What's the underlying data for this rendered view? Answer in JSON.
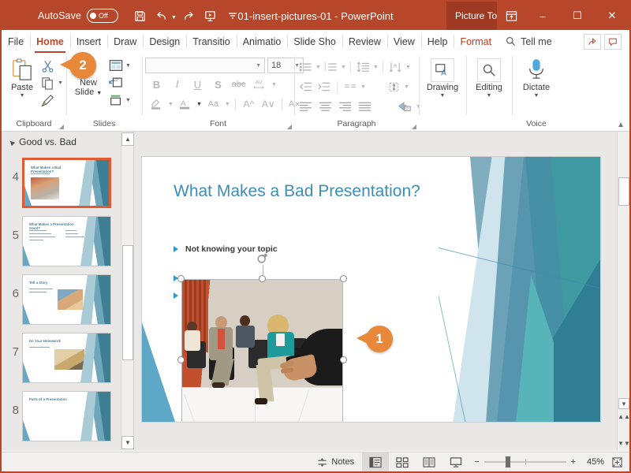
{
  "titlebar": {
    "autosave_label": "AutoSave",
    "autosave_state": "Off",
    "document_title": "01-insert-pictures-01  -  PowerPoint",
    "contextual_tab": "Picture To...",
    "quick_access": [
      {
        "name": "save-icon",
        "label": "Save"
      },
      {
        "name": "undo-icon",
        "label": "Undo"
      },
      {
        "name": "redo-icon",
        "label": "Redo"
      },
      {
        "name": "start-slideshow-icon",
        "label": "Start From Beginning"
      },
      {
        "name": "customize-qat-icon",
        "label": "Customize Quick Access Toolbar"
      }
    ],
    "window_buttons": {
      "ribbon_display": "Ribbon Display Options",
      "minimize": "–",
      "maximize": "☐",
      "close": "✕"
    },
    "accent_color": "#b7472a",
    "contextual_color": "#9e3a21"
  },
  "tabs": [
    {
      "label": "File",
      "active": false
    },
    {
      "label": "Home",
      "active": true
    },
    {
      "label": "Insert",
      "active": false
    },
    {
      "label": "Draw",
      "active": false
    },
    {
      "label": "Design",
      "active": false
    },
    {
      "label": "Transitio",
      "active": false
    },
    {
      "label": "Animatio",
      "active": false
    },
    {
      "label": "Slide Sho",
      "active": false
    },
    {
      "label": "Review",
      "active": false
    },
    {
      "label": "View",
      "active": false
    },
    {
      "label": "Help",
      "active": false
    },
    {
      "label": "Format",
      "active": false
    }
  ],
  "tellme": {
    "label": "Tell me",
    "icon": "search-icon"
  },
  "tab_right_buttons": [
    {
      "name": "share-icon",
      "label": "Share"
    },
    {
      "name": "comments-icon",
      "label": "Comments"
    }
  ],
  "ribbon": {
    "groups": [
      {
        "name": "Clipboard",
        "big_button": {
          "label": "Paste",
          "icon": "paste-icon",
          "has_caret": true
        },
        "small_buttons": [
          {
            "label": "Cut",
            "icon": "cut-icon"
          },
          {
            "label": "Copy",
            "icon": "copy-icon",
            "has_caret": true
          },
          {
            "label": "Format Painter",
            "icon": "format-painter-icon"
          }
        ],
        "has_launcher": true
      },
      {
        "name": "Slides",
        "big_button": {
          "label": "New Slide",
          "icon": "new-slide-icon",
          "has_caret": true
        },
        "small_buttons": [
          {
            "label": "Layout",
            "icon": "layout-icon",
            "has_caret": true
          },
          {
            "label": "Reset",
            "icon": "reset-icon"
          },
          {
            "label": "Section",
            "icon": "section-icon",
            "has_caret": true
          }
        ],
        "has_launcher": false
      },
      {
        "name": "Font",
        "font_name_value": "",
        "font_size_value": "18",
        "buttons": [
          {
            "label": "Bold",
            "icon": "bold-icon",
            "glyph": "B"
          },
          {
            "label": "Italic",
            "icon": "italic-icon",
            "glyph": "I"
          },
          {
            "label": "Underline",
            "icon": "underline-icon",
            "glyph": "U"
          },
          {
            "label": "Text Shadow",
            "icon": "text-shadow-icon",
            "glyph": "S"
          },
          {
            "label": "Strikethrough",
            "icon": "strikethrough-icon",
            "glyph": "abc"
          },
          {
            "label": "Character Spacing",
            "icon": "character-spacing-icon",
            "glyph": "AV"
          },
          {
            "label": "Text Highlight Color",
            "icon": "text-highlight-icon"
          },
          {
            "label": "Font Color",
            "icon": "font-color-icon"
          },
          {
            "label": "Change Case",
            "icon": "change-case-icon",
            "glyph": "Aa"
          },
          {
            "label": "Increase Font Size",
            "icon": "increase-font-size-icon",
            "glyph": "A"
          },
          {
            "label": "Decrease Font Size",
            "icon": "decrease-font-size-icon",
            "glyph": "A"
          },
          {
            "label": "Clear All Formatting",
            "icon": "clear-formatting-icon"
          }
        ],
        "has_launcher": true
      },
      {
        "name": "Paragraph",
        "buttons": [
          {
            "label": "Bullets",
            "icon": "bullets-icon"
          },
          {
            "label": "Numbering",
            "icon": "numbering-icon"
          },
          {
            "label": "Line Spacing",
            "icon": "line-spacing-icon"
          },
          {
            "label": "Text Direction",
            "icon": "text-direction-icon"
          },
          {
            "label": "Decrease Indent",
            "icon": "decrease-indent-icon"
          },
          {
            "label": "Increase Indent",
            "icon": "increase-indent-icon"
          },
          {
            "label": "Add or Remove Columns",
            "icon": "columns-icon"
          },
          {
            "label": "Align Text",
            "icon": "align-text-icon"
          },
          {
            "label": "Align Left",
            "icon": "align-left-icon"
          },
          {
            "label": "Center",
            "icon": "align-center-icon"
          },
          {
            "label": "Align Right",
            "icon": "align-right-icon"
          },
          {
            "label": "Justify",
            "icon": "align-justify-icon"
          },
          {
            "label": "Convert to SmartArt",
            "icon": "smartart-icon"
          }
        ],
        "has_launcher": true
      },
      {
        "name": "",
        "big_button": {
          "label": "Drawing",
          "icon": "drawing-icon",
          "has_caret": true
        }
      },
      {
        "name": "",
        "big_button": {
          "label": "Editing",
          "icon": "editing-icon",
          "has_caret": true
        }
      },
      {
        "name": "Voice",
        "big_button": {
          "label": "Dictate",
          "icon": "dictate-icon",
          "has_caret": true
        }
      }
    ],
    "collapse_label": "Collapse the Ribbon"
  },
  "callouts": [
    {
      "id": "1",
      "number": "1",
      "color": "#e8883a"
    },
    {
      "id": "2",
      "number": "2",
      "color": "#e8883a"
    }
  ],
  "thumbnail_pane": {
    "section_name": "Good vs. Bad",
    "slides": [
      {
        "number": "4",
        "title": "What Makes a Bad Presentation?",
        "selected": true,
        "has_picture": true,
        "lines": 1
      },
      {
        "number": "5",
        "title": "What Makes a Presentation Good?",
        "selected": false,
        "has_picture": false,
        "lines": 4
      },
      {
        "number": "6",
        "title": "Tell a Story",
        "selected": false,
        "has_picture": true,
        "lines": 2
      },
      {
        "number": "7",
        "title": "Do Your Homework",
        "selected": false,
        "has_picture": true,
        "lines": 1
      },
      {
        "number": "8",
        "title": "Parts of a Presentation",
        "selected": false,
        "has_picture": false,
        "lines": 0
      }
    ]
  },
  "slide": {
    "title": "What Makes a Bad Presentation?",
    "bullets": [
      {
        "text": "Not knowing your topic"
      },
      {
        "text": ""
      },
      {
        "text": ""
      }
    ],
    "title_color": "#3c8dba",
    "picture": {
      "name": "bored-audience-photo",
      "selected": true,
      "handles": 8,
      "has_rotation_handle": true
    }
  },
  "statusbar": {
    "notes_label": "Notes",
    "view_buttons": [
      {
        "label": "Normal",
        "icon": "normal-view-icon",
        "active": true
      },
      {
        "label": "Slide Sorter",
        "icon": "slide-sorter-icon",
        "active": false
      },
      {
        "label": "Reading View",
        "icon": "reading-view-icon",
        "active": false
      },
      {
        "label": "Slide Show",
        "icon": "slide-show-icon",
        "active": false
      }
    ],
    "zoom_out": "−",
    "zoom_in": "+",
    "zoom_percent": "45%",
    "fit_label": "Fit slide to current window"
  }
}
